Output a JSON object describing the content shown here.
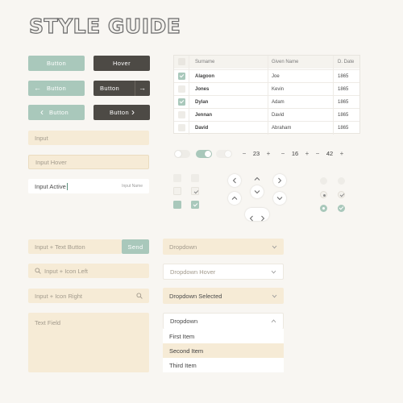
{
  "header": {
    "title": "STYLE GUIDE"
  },
  "buttons": {
    "button": "Button",
    "hover": "Hover",
    "button_arrow_left": "Button",
    "button_arrow_right": "Button",
    "button_chevron_left": "Button",
    "button_chevron_right": "Button",
    "arrow_left_glyph": "←",
    "arrow_right_glyph": "→",
    "chevron_left_glyph": "‹",
    "chevron_right_glyph": "›"
  },
  "inputs": {
    "input": "Input",
    "input_hover": "Input Hover",
    "input_active_value": "Input Active",
    "input_active_label": "Input Name",
    "input_text_button": "Input + Text Button",
    "send_label": "Send",
    "input_icon_left": "Input + Icon Left",
    "input_icon_right": "Input + Icon Right",
    "text_field": "Text Field"
  },
  "table": {
    "headers": [
      "Surname",
      "Given Name",
      "D. Date"
    ],
    "rows": [
      {
        "surname": "Alagoon",
        "given": "Joe",
        "date": "1865",
        "checked": true
      },
      {
        "surname": "Jones",
        "given": "Kevin",
        "date": "1865",
        "checked": false
      },
      {
        "surname": "Dylan",
        "given": "Adam",
        "date": "1865",
        "checked": true
      },
      {
        "surname": "Jennan",
        "given": "David",
        "date": "1865",
        "checked": false
      },
      {
        "surname": "David",
        "given": "Abraham",
        "date": "1865",
        "checked": false
      }
    ]
  },
  "steppers": [
    {
      "minus": "−",
      "value": "23",
      "plus": "+"
    },
    {
      "minus": "−",
      "value": "16",
      "plus": "+"
    },
    {
      "minus": "−",
      "value": "42",
      "plus": "+"
    }
  ],
  "dropdowns": {
    "default": "Dropdown",
    "hover": "Dropdown Hover",
    "selected": "Dropdown Selected",
    "open": "Dropdown",
    "options": [
      "First Item",
      "Second Item",
      "Third Item"
    ],
    "highlighted_option": "Second Item"
  },
  "colors": {
    "accent": "#a9c8bb",
    "dark": "#4d4a45",
    "input_bg": "#f6ebd6",
    "page_bg": "#f8f6f2"
  }
}
